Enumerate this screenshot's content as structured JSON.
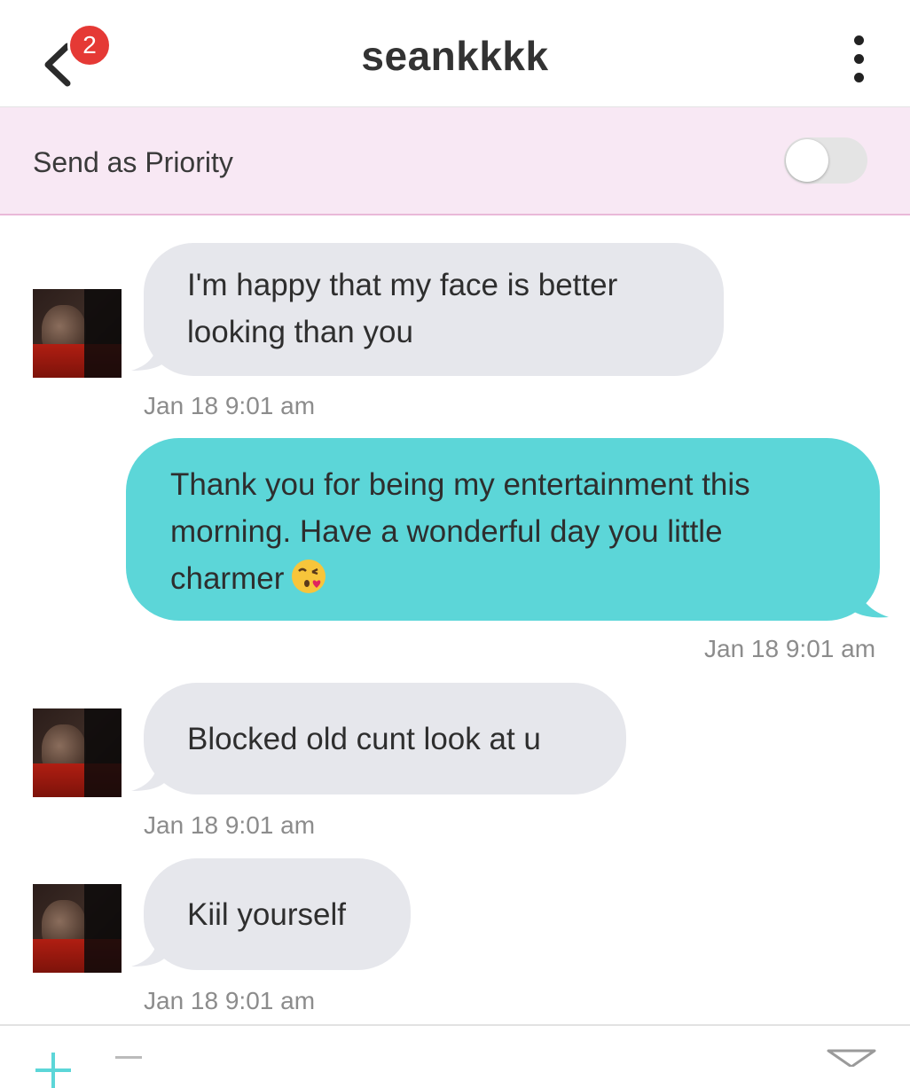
{
  "header": {
    "title": "seankkkk",
    "badge_count": "2",
    "back_icon": "chevron-left-icon",
    "more_icon": "more-vertical-icon"
  },
  "priority": {
    "label": "Send as Priority",
    "enabled": false
  },
  "messages": [
    {
      "direction": "incoming",
      "text_lines": [
        "I'm happy that my face is better",
        "looking than you"
      ],
      "time": "Jan 18 9:01 am"
    },
    {
      "direction": "outgoing",
      "text_lines": [
        "Thank you for being my entertainment this",
        "morning. Have a wonderful day you little",
        "charmer"
      ],
      "emoji": "face-blowing-kiss-emoji",
      "time": "Jan 18 9:01 am"
    },
    {
      "direction": "incoming",
      "text_lines": [
        "Blocked old cunt look at u"
      ],
      "time": "Jan 18 9:01 am"
    },
    {
      "direction": "incoming",
      "text_lines": [
        "Kiil yourself"
      ],
      "time": "Jan 18 9:01 am"
    }
  ],
  "colors": {
    "incoming_bubble": "#e6e7ec",
    "outgoing_bubble": "#5cd6d8",
    "priority_bar": "#f8e8f4",
    "badge": "#e53935"
  },
  "composer": {
    "attach_icon": "plus-icon",
    "send_icon": "send-icon"
  }
}
